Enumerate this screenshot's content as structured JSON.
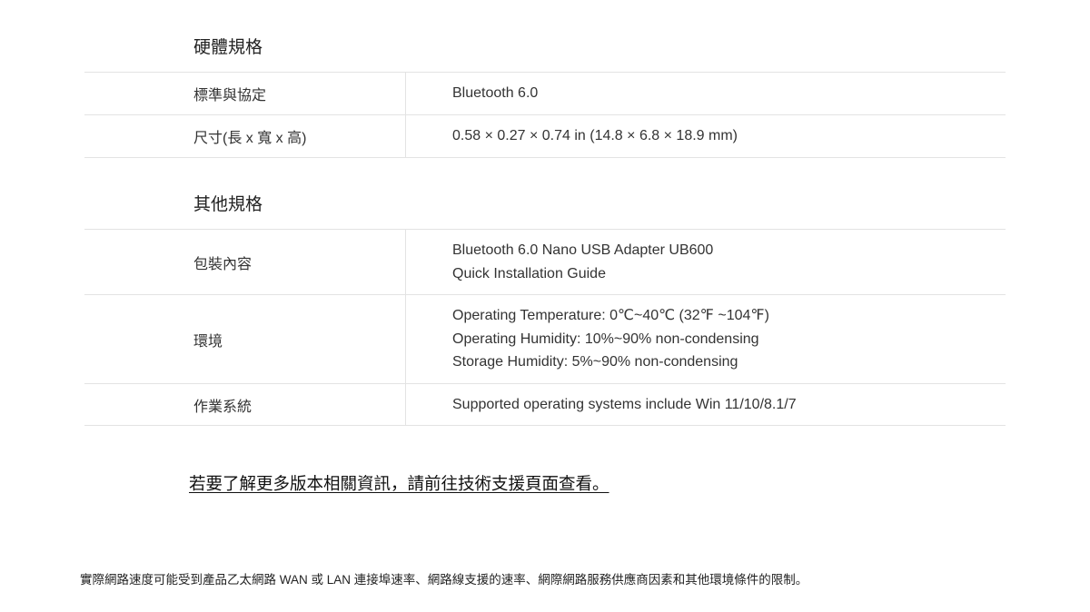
{
  "hardware": {
    "title": "硬體規格",
    "rows": [
      {
        "label": "標準與協定",
        "values": [
          "Bluetooth 6.0"
        ]
      },
      {
        "label": "尺寸(長 x 寬 x 高)",
        "values": [
          "0.58 × 0.27 × 0.74 in (14.8 × 6.8 × 18.9 mm)"
        ]
      }
    ]
  },
  "other": {
    "title": "其他規格",
    "rows": [
      {
        "label": "包裝內容",
        "values": [
          "Bluetooth 6.0 Nano USB Adapter UB600",
          "Quick Installation Guide"
        ]
      },
      {
        "label": "環境",
        "values": [
          "Operating Temperature: 0℃~40℃ (32℉ ~104℉)",
          "Operating Humidity: 10%~90% non-condensing",
          "Storage Humidity: 5%~90% non-condensing"
        ]
      },
      {
        "label": "作業系統",
        "values": [
          "Supported operating systems include Win 11/10/8.1/7"
        ]
      }
    ]
  },
  "more_info_link": "若要了解更多版本相關資訊，請前往技術支援頁面查看。",
  "disclaimer": "實際網路速度可能受到產品乙太網路 WAN 或 LAN 連接埠速率、網路線支援的速率、網際網路服務供應商因素和其他環境條件的限制。"
}
